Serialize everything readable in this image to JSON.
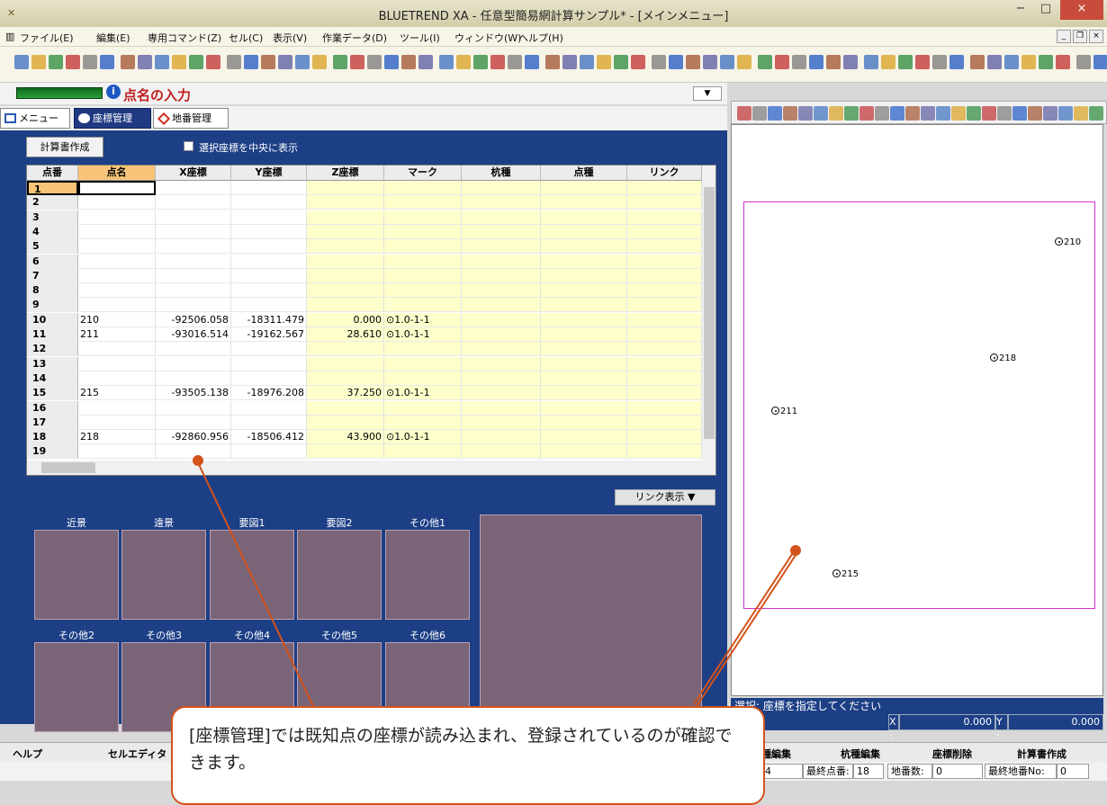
{
  "window": {
    "title": "BLUETREND XA - 任意型簡易網計算サンプル* - [メインメニュー]",
    "min": "−",
    "max": "□",
    "close": "×"
  },
  "menu": [
    "ファイル(E)",
    "編集(E)",
    "専用コマンド(Z)",
    "セル(C)",
    "表示(V)",
    "作業データ(D)",
    "ツール(I)",
    "ウィンドウ(W)",
    "ヘルプ(H)"
  ],
  "page": {
    "title": "点名の入力",
    "dropdown": "▼"
  },
  "tabs": [
    "メニュー",
    "座標管理",
    "地番管理"
  ],
  "panel": {
    "calc_button": "計算書作成",
    "checkbox_label": "選択座標を中央に表示",
    "link_button": "リンク表示 ▼"
  },
  "grid": {
    "headers": [
      "点番",
      "点名",
      "X座標",
      "Y座標",
      "Z座標",
      "マーク",
      "杭種",
      "点種",
      "リンク"
    ],
    "rows": [
      [
        "1",
        "",
        "",
        "",
        "",
        "",
        "",
        "",
        ""
      ],
      [
        "2",
        "",
        "",
        "",
        "",
        "",
        "",
        "",
        ""
      ],
      [
        "3",
        "",
        "",
        "",
        "",
        "",
        "",
        "",
        ""
      ],
      [
        "4",
        "",
        "",
        "",
        "",
        "",
        "",
        "",
        ""
      ],
      [
        "5",
        "",
        "",
        "",
        "",
        "",
        "",
        "",
        ""
      ],
      [
        "6",
        "",
        "",
        "",
        "",
        "",
        "",
        "",
        ""
      ],
      [
        "7",
        "",
        "",
        "",
        "",
        "",
        "",
        "",
        ""
      ],
      [
        "8",
        "",
        "",
        "",
        "",
        "",
        "",
        "",
        ""
      ],
      [
        "9",
        "",
        "",
        "",
        "",
        "",
        "",
        "",
        ""
      ],
      [
        "10",
        "210",
        "-92506.058",
        "-18311.479",
        "0.000",
        "⊙1.0-1-1",
        "",
        "",
        ""
      ],
      [
        "11",
        "211",
        "-93016.514",
        "-19162.567",
        "28.610",
        "⊙1.0-1-1",
        "",
        "",
        ""
      ],
      [
        "12",
        "",
        "",
        "",
        "",
        "",
        "",
        "",
        ""
      ],
      [
        "13",
        "",
        "",
        "",
        "",
        "",
        "",
        "",
        ""
      ],
      [
        "14",
        "",
        "",
        "",
        "",
        "",
        "",
        "",
        ""
      ],
      [
        "15",
        "215",
        "-93505.138",
        "-18976.208",
        "37.250",
        "⊙1.0-1-1",
        "",
        "",
        ""
      ],
      [
        "16",
        "",
        "",
        "",
        "",
        "",
        "",
        "",
        ""
      ],
      [
        "17",
        "",
        "",
        "",
        "",
        "",
        "",
        "",
        ""
      ],
      [
        "18",
        "218",
        "-92860.956",
        "-18506.412",
        "43.900",
        "⊙1.0-1-1",
        "",
        "",
        ""
      ],
      [
        "19",
        "",
        "",
        "",
        "",
        "",
        "",
        "",
        ""
      ]
    ]
  },
  "photos": {
    "row1": [
      "近景",
      "遠景",
      "要図1",
      "要図2",
      "その他1"
    ],
    "row2": [
      "その他2",
      "その他3",
      "その他4",
      "その他5",
      "その他6"
    ]
  },
  "plot": {
    "points": [
      "210",
      "218",
      "211",
      "215"
    ]
  },
  "status": {
    "select": "選択: 座標を指定してください",
    "x_label": "X :",
    "x_value": "0.000",
    "y_label": "Y :",
    "y_value": "0.000"
  },
  "fnbar": [
    "ヘルプ",
    "セルエディタ",
    "種編集",
    "杭種編集",
    "座標削除",
    "計算書作成"
  ],
  "info": {
    "count": "4",
    "last_label": "最終点番:",
    "last_value": "18",
    "lot_label": "地番数:",
    "lot_value": "0",
    "lastlot_label": "最終地番No:",
    "lastlot_value": "0"
  },
  "callout": "[座標管理]では既知点の座標が読み込まれ、登録されているのが確認できます。",
  "colors": {
    "panel": "#1d3f86",
    "accent": "#d3531c",
    "highlight": "#f7c478",
    "zcol": "#ffffcc",
    "frame": "#d030d0"
  }
}
